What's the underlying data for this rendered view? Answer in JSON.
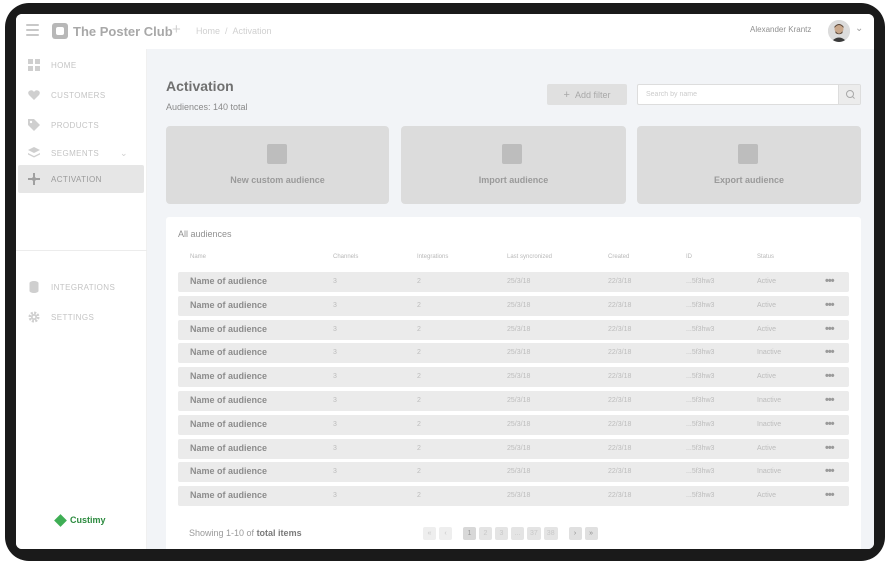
{
  "app": {
    "title": "The Poster Club"
  },
  "breadcrumb": {
    "home": "Home",
    "current": "Activation"
  },
  "user": {
    "name": "Alexander Krantz"
  },
  "sidebar": {
    "items": [
      {
        "label": "HOME",
        "icon": "grid-icon"
      },
      {
        "label": "CUSTOMERS",
        "icon": "heart-icon"
      },
      {
        "label": "PRODUCTS",
        "icon": "tag-icon"
      },
      {
        "label": "SEGMENTS",
        "icon": "layers-icon"
      },
      {
        "label": "ACTIVATION",
        "icon": "activation-icon",
        "active": true
      },
      {
        "label": "INTEGRATIONS",
        "icon": "database-icon"
      },
      {
        "label": "SETTINGS",
        "icon": "gear-icon"
      }
    ],
    "brand": "Custimy"
  },
  "page": {
    "title": "Activation",
    "subtitle": "Audiences: 140 total",
    "add_filter": "Add filter",
    "search_placeholder": "Search by name"
  },
  "cards": [
    {
      "label": "New custom audience"
    },
    {
      "label": "Import audience"
    },
    {
      "label": "Export audience"
    }
  ],
  "table": {
    "title": "All audiences",
    "columns": [
      "Name",
      "Channels",
      "Integrations",
      "Last syncronized",
      "Created",
      "ID",
      "Status"
    ],
    "rows": [
      {
        "name": "Name of audience",
        "channels": "3",
        "integrations": "2",
        "synced": "25/3/18",
        "created": "22/3/18",
        "id": "...5f3hw3",
        "status": "Active"
      },
      {
        "name": "Name of audience",
        "channels": "3",
        "integrations": "2",
        "synced": "25/3/18",
        "created": "22/3/18",
        "id": "...5f3hw3",
        "status": "Active"
      },
      {
        "name": "Name of audience",
        "channels": "3",
        "integrations": "2",
        "synced": "25/3/18",
        "created": "22/3/18",
        "id": "...5f3hw3",
        "status": "Active"
      },
      {
        "name": "Name of audience",
        "channels": "3",
        "integrations": "2",
        "synced": "25/3/18",
        "created": "22/3/18",
        "id": "...5f3hw3",
        "status": "Inactive"
      },
      {
        "name": "Name of audience",
        "channels": "3",
        "integrations": "2",
        "synced": "25/3/18",
        "created": "22/3/18",
        "id": "...5f3hw3",
        "status": "Active"
      },
      {
        "name": "Name of audience",
        "channels": "3",
        "integrations": "2",
        "synced": "25/3/18",
        "created": "22/3/18",
        "id": "...5f3hw3",
        "status": "Inactive"
      },
      {
        "name": "Name of audience",
        "channels": "3",
        "integrations": "2",
        "synced": "25/3/18",
        "created": "22/3/18",
        "id": "...5f3hw3",
        "status": "Inactive"
      },
      {
        "name": "Name of audience",
        "channels": "3",
        "integrations": "2",
        "synced": "25/3/18",
        "created": "22/3/18",
        "id": "...5f3hw3",
        "status": "Active"
      },
      {
        "name": "Name of audience",
        "channels": "3",
        "integrations": "2",
        "synced": "25/3/18",
        "created": "22/3/18",
        "id": "...5f3hw3",
        "status": "Inactive"
      },
      {
        "name": "Name of audience",
        "channels": "3",
        "integrations": "2",
        "synced": "25/3/18",
        "created": "22/3/18",
        "id": "...5f3hw3",
        "status": "Active"
      }
    ],
    "more_glyph": "•••"
  },
  "footer": {
    "showing_prefix": "Showing 1-10 of",
    "showing_bold": "total items"
  },
  "pagination": {
    "first": "«",
    "prev": "‹",
    "pages": [
      "1",
      "2",
      "3",
      "...",
      "37",
      "38"
    ],
    "next": "›",
    "last": "»"
  },
  "colors": {
    "brand": "#3fae55",
    "card": "#dcdcdc",
    "row": "#ebebeb"
  }
}
